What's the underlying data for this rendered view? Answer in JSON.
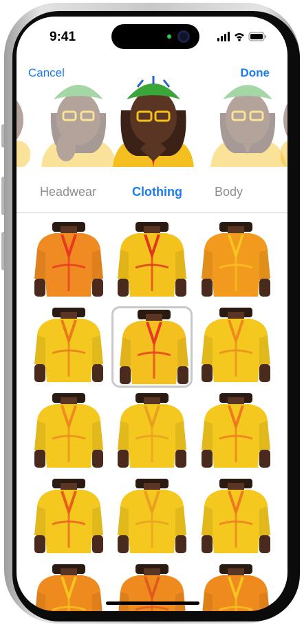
{
  "status_bar": {
    "time": "9:41"
  },
  "nav": {
    "cancel_label": "Cancel",
    "done_label": "Done"
  },
  "tabs": [
    {
      "label": "Headwear",
      "active": false
    },
    {
      "label": "Clothing",
      "active": true
    },
    {
      "label": "Body",
      "active": false
    }
  ],
  "clothing_options": [
    {
      "name": "orange-swirl-dress",
      "base": "#f08a22",
      "accent": "#e8381f",
      "selected": false
    },
    {
      "name": "yellow-red-pattern-top",
      "base": "#f3c21c",
      "accent": "#e0371f",
      "selected": false
    },
    {
      "name": "orange-striped-top",
      "base": "#f29a1e",
      "accent": "#f5c41e",
      "selected": false
    },
    {
      "name": "yellow-hoodie",
      "base": "#f4c81f",
      "accent": "#e97a1c",
      "selected": false
    },
    {
      "name": "yellow-dashiki",
      "base": "#f4c020",
      "accent": "#e53a1f",
      "selected": true
    },
    {
      "name": "yellow-tunic",
      "base": "#f4c81f",
      "accent": "#ee8a1e",
      "selected": false
    },
    {
      "name": "yellow-pocket-hoodie",
      "base": "#f4c81f",
      "accent": "#ee8a1e",
      "selected": false
    },
    {
      "name": "yellow-wrap-top",
      "base": "#f4c81f",
      "accent": "#e8a01e",
      "selected": false
    },
    {
      "name": "yellow-wrap-skirt",
      "base": "#f4c81f",
      "accent": "#ee7a1e",
      "selected": false
    },
    {
      "name": "yellow-floral-blouse",
      "base": "#f4c81f",
      "accent": "#e85c1e",
      "selected": false
    },
    {
      "name": "yellow-off-shoulder-top",
      "base": "#f4c81f",
      "accent": "#e8a01e",
      "selected": false
    },
    {
      "name": "yellow-qipao-top",
      "base": "#f4c81f",
      "accent": "#ee7a1e",
      "selected": false
    },
    {
      "name": "orange-sash-top",
      "base": "#ee8a1e",
      "accent": "#f5c41e",
      "selected": false
    },
    {
      "name": "orange-button-top",
      "base": "#ee8a1e",
      "accent": "#e05a1e",
      "selected": false
    },
    {
      "name": "orange-collar-top",
      "base": "#ee8a1e",
      "accent": "#f5c41e",
      "selected": false
    }
  ],
  "colors": {
    "accent": "#1a7cf0",
    "tab_inactive": "#8e8e93",
    "helmet": "#3aa63a",
    "skin": "#5a3524"
  }
}
